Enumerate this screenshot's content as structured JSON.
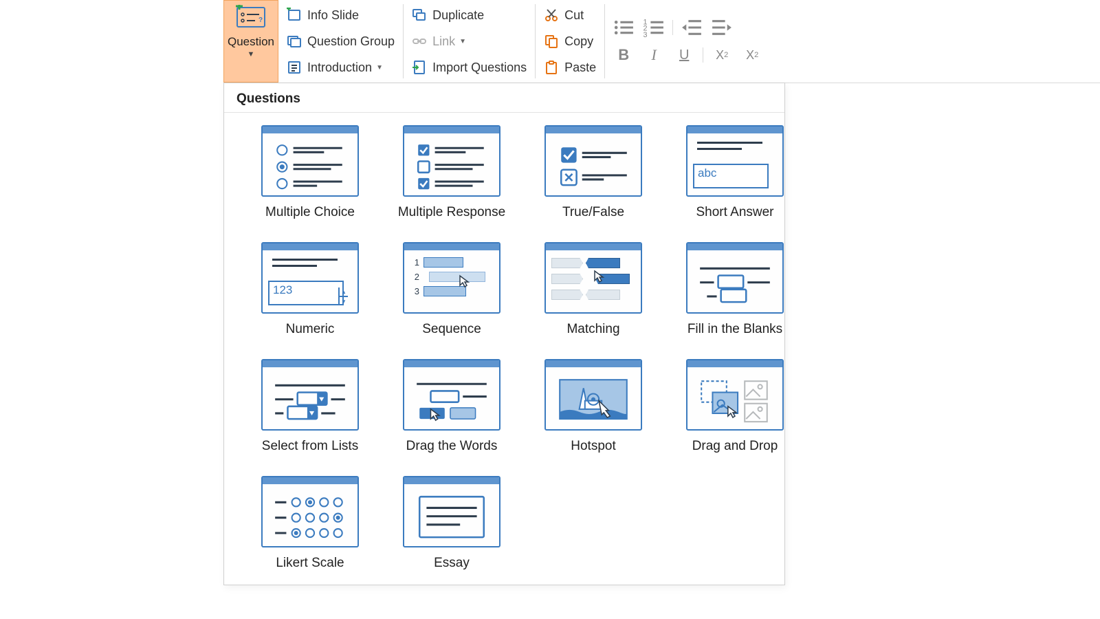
{
  "ribbon": {
    "question_label": "Question",
    "info_slide": "Info Slide",
    "question_group": "Question Group",
    "introduction": "Introduction",
    "duplicate": "Duplicate",
    "link": "Link",
    "import_questions": "Import Questions",
    "cut": "Cut",
    "copy": "Copy",
    "paste": "Paste"
  },
  "panel": {
    "title": "Questions"
  },
  "question_types": [
    {
      "id": "multiple-choice",
      "label": "Multiple Choice"
    },
    {
      "id": "multiple-response",
      "label": "Multiple Response"
    },
    {
      "id": "true-false",
      "label": "True/False"
    },
    {
      "id": "short-answer",
      "label": "Short Answer",
      "sample": "abc"
    },
    {
      "id": "numeric",
      "label": "Numeric",
      "sample": "123"
    },
    {
      "id": "sequence",
      "label": "Sequence",
      "nums": [
        "1",
        "2",
        "3"
      ]
    },
    {
      "id": "matching",
      "label": "Matching"
    },
    {
      "id": "fill-blanks",
      "label": "Fill in the Blanks"
    },
    {
      "id": "select-lists",
      "label": "Select from Lists"
    },
    {
      "id": "drag-words",
      "label": "Drag the Words"
    },
    {
      "id": "hotspot",
      "label": "Hotspot"
    },
    {
      "id": "drag-drop",
      "label": "Drag and Drop"
    },
    {
      "id": "likert",
      "label": "Likert Scale"
    },
    {
      "id": "essay",
      "label": "Essay"
    }
  ]
}
